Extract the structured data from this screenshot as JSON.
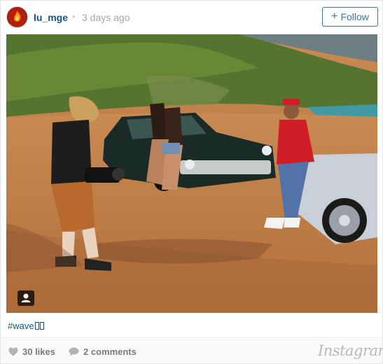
{
  "post": {
    "username": "lu_mge",
    "separator": "•",
    "timestamp": "3 days ago",
    "follow_label": "Follow",
    "follow_icon": "plus-icon",
    "avatar_icon": "flame-avatar",
    "caption": "#wave",
    "likes": "30 likes",
    "comments": "2 comments",
    "brand": "Instagram"
  },
  "colors": {
    "link": "#125688",
    "follow": "#3f729b",
    "muted": "#a5a7aa"
  }
}
